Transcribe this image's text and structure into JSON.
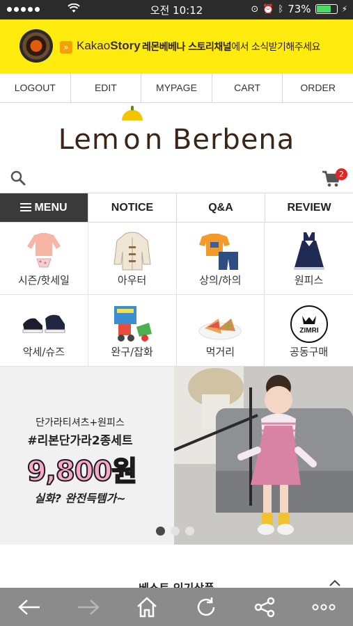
{
  "status_bar": {
    "time": "오전 10:12",
    "battery_percent": "73%",
    "battery_level": 0.73
  },
  "kakao": {
    "brand_light": "Kakao",
    "brand_bold": "Story",
    "message_bold": "레몬베베나 스토리채널",
    "message_rest": "에서 소식받기해주세요"
  },
  "top_nav": {
    "items": [
      "LOGOUT",
      "EDIT",
      "MYPAGE",
      "CART",
      "ORDER"
    ]
  },
  "logo": {
    "part1": "Lem",
    "part2": "n Berbena"
  },
  "cart": {
    "badge_count": "2"
  },
  "menu_tabs": {
    "items": [
      "MENU",
      "NOTICE",
      "Q&A",
      "REVIEW"
    ]
  },
  "categories": [
    {
      "label": "시즌/핫세일",
      "icon": "swimwear-icon"
    },
    {
      "label": "아우터",
      "icon": "coat-icon"
    },
    {
      "label": "상의/하의",
      "icon": "top-bottom-icon"
    },
    {
      "label": "원피스",
      "icon": "dress-icon"
    },
    {
      "label": "악세/슈즈",
      "icon": "shoes-icon"
    },
    {
      "label": "완구/잡화",
      "icon": "toy-icon"
    },
    {
      "label": "먹거리",
      "icon": "food-icon"
    },
    {
      "label": "공동구매",
      "icon": "zimri-logo-icon",
      "logo_text": "ZIMRI"
    }
  ],
  "promo": {
    "subtitle": "단가라티셔츠+원피스",
    "title": "#리본단가라2종세트",
    "price": "9,800원",
    "tagline": "실화? 완전득템가~",
    "slide_count": 3,
    "active_slide": 1
  },
  "section": {
    "title": "베스트 인기상품"
  },
  "colors": {
    "kakao_yellow": "#ffeb0e",
    "menu_dark": "#3a3a3a",
    "badge_red": "#e3241f",
    "toolbar_gray": "#8b8b8b"
  }
}
